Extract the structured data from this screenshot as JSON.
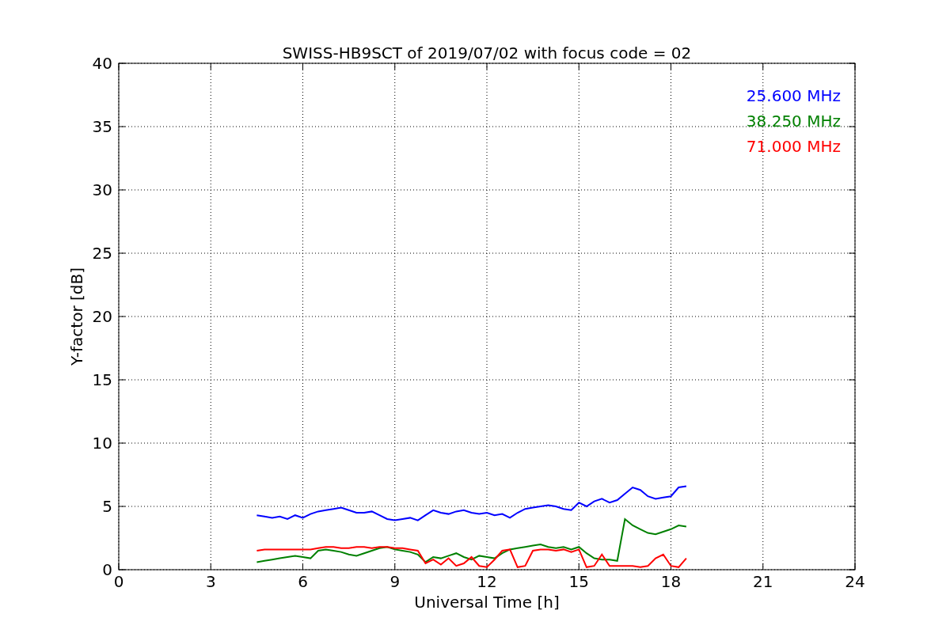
{
  "chart": {
    "chart_data": {
      "type": "line",
      "title": "SWISS-HB9SCT of 2019/07/02 with focus code = 02",
      "xlabel": "Universal Time [h]",
      "ylabel": "Y-factor [dB]",
      "x": [
        4.5,
        4.75,
        5,
        5.25,
        5.5,
        5.75,
        6,
        6.25,
        6.5,
        6.75,
        7,
        7.25,
        7.5,
        7.75,
        8,
        8.25,
        8.5,
        8.75,
        9,
        9.25,
        9.5,
        9.75,
        10,
        10.25,
        10.5,
        10.75,
        11,
        11.25,
        11.5,
        11.75,
        12,
        12.25,
        12.5,
        12.75,
        13,
        13.25,
        13.5,
        13.75,
        14,
        14.25,
        14.5,
        14.75,
        15,
        15.25,
        15.5,
        15.75,
        16,
        16.25,
        16.5,
        16.75,
        17,
        17.25,
        17.5,
        17.75,
        18,
        18.25,
        18.5
      ],
      "series": [
        {
          "name": "25.600 MHz",
          "color": "#0000ff",
          "values": [
            4.3,
            4.2,
            4.1,
            4.2,
            4.0,
            4.3,
            4.1,
            4.4,
            4.6,
            4.7,
            4.8,
            4.9,
            4.7,
            4.5,
            4.5,
            4.6,
            4.3,
            4.0,
            3.9,
            4.0,
            4.1,
            3.9,
            4.3,
            4.7,
            4.5,
            4.4,
            4.6,
            4.7,
            4.5,
            4.4,
            4.5,
            4.3,
            4.4,
            4.1,
            4.5,
            4.8,
            4.9,
            5.0,
            5.1,
            5.0,
            4.8,
            4.7,
            5.3,
            5.0,
            5.4,
            5.6,
            5.3,
            5.5,
            6.0,
            6.5,
            6.3,
            5.8,
            5.6,
            5.7,
            5.8,
            6.5,
            6.6
          ]
        },
        {
          "name": "38.250 MHz",
          "color": "#008000",
          "values": [
            0.6,
            0.7,
            0.8,
            0.9,
            1.0,
            1.1,
            1.0,
            0.9,
            1.5,
            1.6,
            1.5,
            1.4,
            1.2,
            1.1,
            1.3,
            1.5,
            1.7,
            1.8,
            1.6,
            1.5,
            1.4,
            1.2,
            0.6,
            1.0,
            0.9,
            1.1,
            1.3,
            1.0,
            0.8,
            1.1,
            1.0,
            0.9,
            1.3,
            1.6,
            1.7,
            1.8,
            1.9,
            2.0,
            1.8,
            1.7,
            1.8,
            1.6,
            1.8,
            1.3,
            0.9,
            0.8,
            0.8,
            0.7,
            4.0,
            3.5,
            3.2,
            2.9,
            2.8,
            3.0,
            3.2,
            3.5,
            3.4
          ]
        },
        {
          "name": "71.000 MHz",
          "color": "#ff0000",
          "values": [
            1.5,
            1.6,
            1.6,
            1.6,
            1.6,
            1.6,
            1.6,
            1.6,
            1.7,
            1.8,
            1.8,
            1.7,
            1.7,
            1.8,
            1.8,
            1.7,
            1.8,
            1.8,
            1.7,
            1.7,
            1.6,
            1.5,
            0.5,
            0.8,
            0.4,
            0.9,
            0.3,
            0.5,
            1.0,
            0.3,
            0.2,
            0.8,
            1.5,
            1.6,
            0.2,
            0.3,
            1.5,
            1.6,
            1.6,
            1.5,
            1.6,
            1.4,
            1.6,
            0.2,
            0.3,
            1.2,
            0.3,
            0.3,
            0.3,
            0.3,
            0.2,
            0.3,
            0.9,
            1.2,
            0.3,
            0.2,
            0.9
          ]
        }
      ],
      "grid": true,
      "xlim": [
        0,
        24
      ],
      "ylim": [
        0,
        40
      ],
      "xticks": [
        0,
        3,
        6,
        9,
        12,
        15,
        18,
        21,
        24
      ],
      "yticks": [
        0,
        5,
        10,
        15,
        20,
        25,
        30,
        35,
        40
      ]
    }
  }
}
